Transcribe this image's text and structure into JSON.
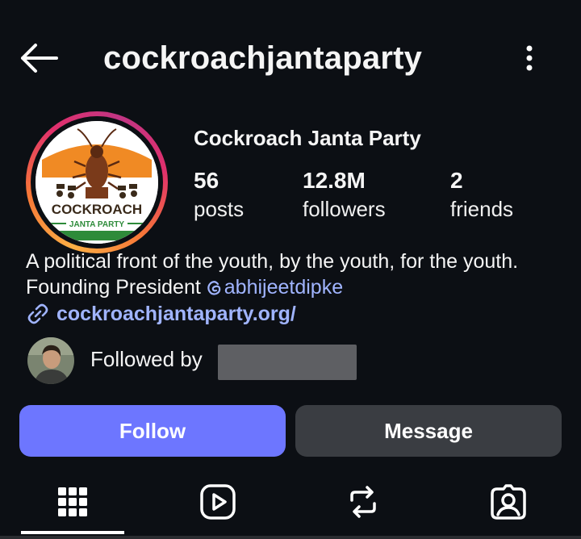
{
  "header": {
    "username": "cockroachjantaparty",
    "back_icon": "arrow-left-icon",
    "more_icon": "vertical-dots-icon"
  },
  "profile": {
    "display_name": "Cockroach Janta Party",
    "avatar_logo": {
      "line1": "COCKROACH",
      "line2": "JANTA PARTY",
      "colors": {
        "saffron": "#f08a24",
        "green": "#2e8b3a",
        "brown": "#7a3a1a"
      }
    },
    "stats": [
      {
        "value": "56",
        "label": "posts"
      },
      {
        "value": "12.8M",
        "label": "followers"
      },
      {
        "value": "2",
        "label": "friends"
      }
    ],
    "bio_text": "A political front of the youth, by the youth, for the youth. Founding President ",
    "bio_mention": "abhijeetdipke",
    "link": "cockroachjantaparty.org/",
    "followed_by_label": "Followed by"
  },
  "actions": {
    "follow_label": "Follow",
    "message_label": "Message"
  },
  "tabs": [
    {
      "icon": "grid-icon",
      "active": true
    },
    {
      "icon": "reels-icon",
      "active": false
    },
    {
      "icon": "reposts-icon",
      "active": false
    },
    {
      "icon": "tagged-icon",
      "active": false
    }
  ],
  "colors": {
    "background": "#0c0f14",
    "accent_link": "#a0b4ff",
    "follow_button": "#6d76ff",
    "message_button": "#3a3d42"
  }
}
